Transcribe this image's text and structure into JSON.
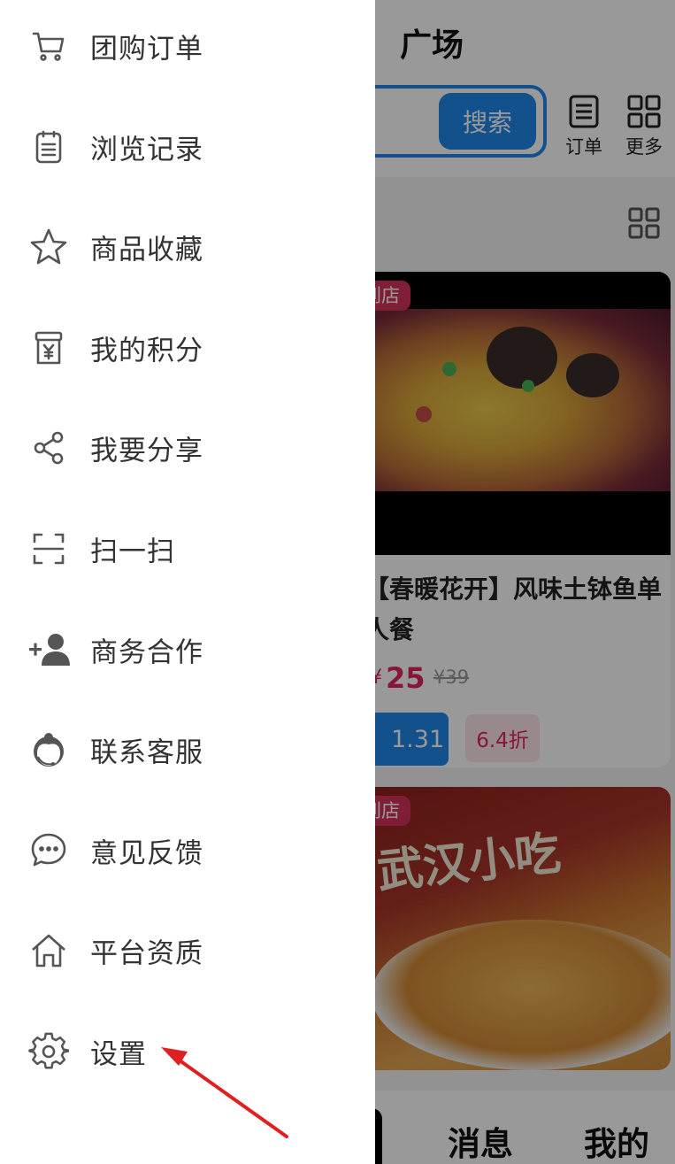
{
  "header": {
    "title": "广场"
  },
  "search": {
    "button_label": "搜索"
  },
  "top_actions": [
    {
      "label": "订单"
    },
    {
      "label": "更多"
    }
  ],
  "products": [
    {
      "tag": "到店",
      "title": "【春暖花开】风味土钵鱼单人餐",
      "currency": "¥",
      "price": "25",
      "original_price": "¥39",
      "coin": "1.31",
      "discount": "6.4折"
    },
    {
      "tag": "到店",
      "image_text": "武汉小吃"
    }
  ],
  "bottom_nav": {
    "messages": "消息",
    "mine": "我的"
  },
  "drawer": {
    "items": [
      {
        "label": "团购订单",
        "icon": "cart-icon"
      },
      {
        "label": "浏览记录",
        "icon": "clipboard-icon"
      },
      {
        "label": "商品收藏",
        "icon": "star-icon"
      },
      {
        "label": "我的积分",
        "icon": "points-icon"
      },
      {
        "label": "我要分享",
        "icon": "share-icon"
      },
      {
        "label": "扫一扫",
        "icon": "scan-icon"
      },
      {
        "label": "商务合作",
        "icon": "add-person-icon"
      },
      {
        "label": "联系客服",
        "icon": "customer-service-icon"
      },
      {
        "label": "意见反馈",
        "icon": "chat-bubble-icon"
      },
      {
        "label": "平台资质",
        "icon": "home-icon"
      },
      {
        "label": "设置",
        "icon": "gear-icon"
      }
    ]
  },
  "colors": {
    "accent": "#1f87e8",
    "price": "#e0245e",
    "annotation_arrow": "#e02020"
  }
}
